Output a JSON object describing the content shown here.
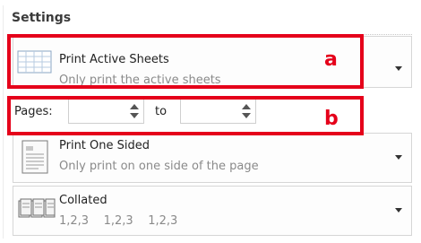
{
  "settings": {
    "title": "Settings"
  },
  "print_what": {
    "label": "Print Active Sheets",
    "description": "Only print the active sheets",
    "icon": "sheet-grid-icon"
  },
  "pages": {
    "label": "Pages:",
    "from_value": "",
    "to_label": "to",
    "to_value": ""
  },
  "sides": {
    "label": "Print One Sided",
    "description": "Only print on one side of the page",
    "icon": "one-sided-page-icon"
  },
  "collation": {
    "label": "Collated",
    "description": "1,2,3    1,2,3    1,2,3",
    "icon": "collated-pages-icon"
  },
  "callouts": {
    "a": "a",
    "b": "b"
  },
  "colors": {
    "callout": "#e5001a",
    "border": "#d6d6d6"
  }
}
